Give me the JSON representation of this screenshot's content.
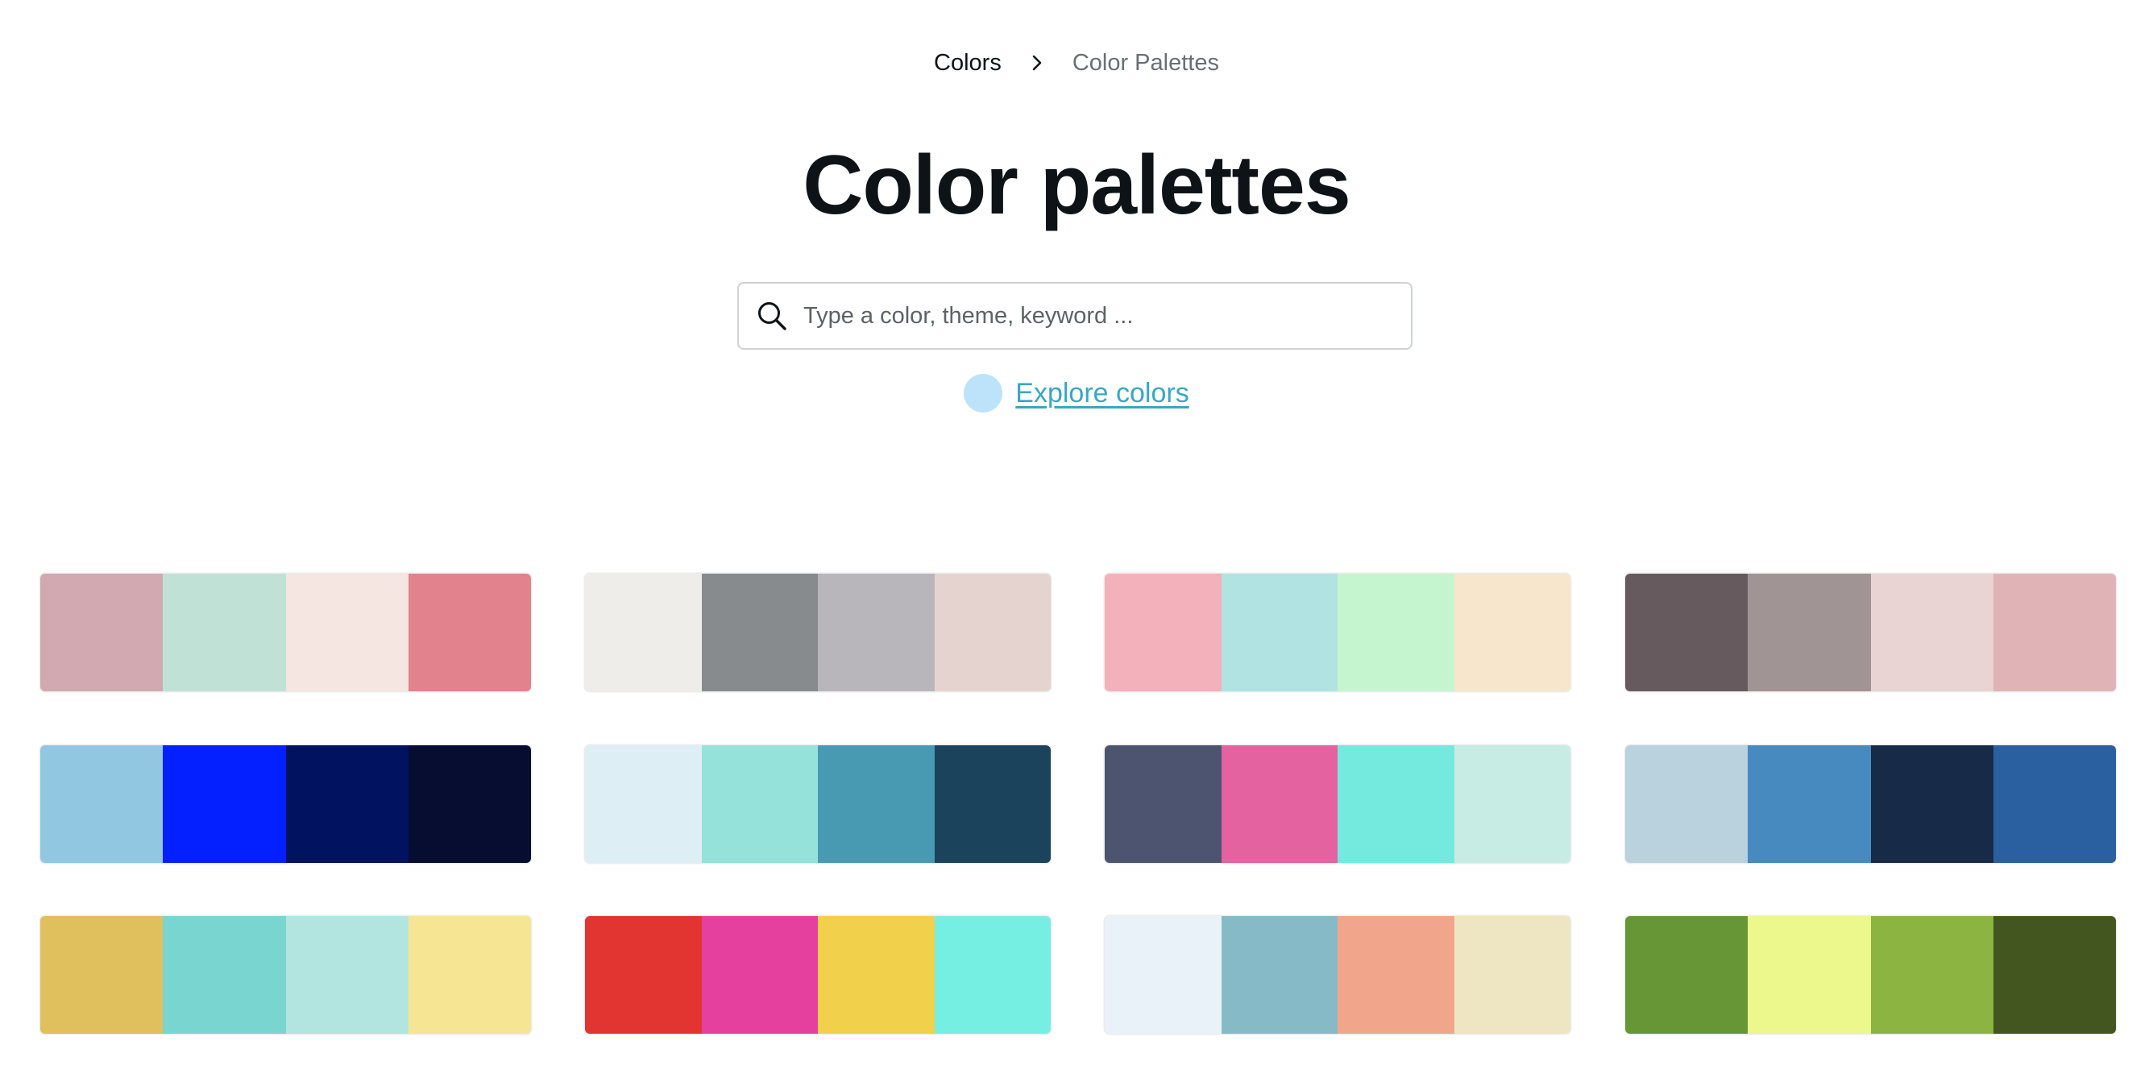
{
  "breadcrumb": {
    "root": "Colors",
    "current": "Color Palettes"
  },
  "page_title": "Color palettes",
  "search": {
    "placeholder": "Type a color, theme, keyword ...",
    "value": ""
  },
  "explore": {
    "label": "Explore colors",
    "dot_color": "#bde3fb"
  },
  "palettes": [
    [
      "#d3a9b1",
      "#c0e2d6",
      "#f5e6e1",
      "#e1828d"
    ],
    [
      "#eeede9",
      "#888b8e",
      "#b8b6bb",
      "#e4d3ce"
    ],
    [
      "#f3b1bb",
      "#b1e3e3",
      "#c5f5cf",
      "#f7e6cb"
    ],
    [
      "#665a5f",
      "#a09495",
      "#e9d4d3",
      "#e0b4b6"
    ],
    [
      "#92c7e2",
      "#0420ff",
      "#011360",
      "#060d31"
    ],
    [
      "#ddeff4",
      "#94e2da",
      "#489ab2",
      "#1c435c"
    ],
    [
      "#4d546f",
      "#e4629f",
      "#74e9de",
      "#c7ece3"
    ],
    [
      "#bad1de",
      "#478ac0",
      "#172b48",
      "#2b60a0"
    ],
    [
      "#dfc05c",
      "#78d5d0",
      "#b2e5e0",
      "#f6e694"
    ],
    [
      "#e23532",
      "#e6409e",
      "#f1d14c",
      "#76efe3"
    ],
    [
      "#e9f1f9",
      "#86bac7",
      "#f1a68b",
      "#eee6c3"
    ],
    [
      "#679636",
      "#ecf78c",
      "#8cb441",
      "#43561f"
    ]
  ]
}
